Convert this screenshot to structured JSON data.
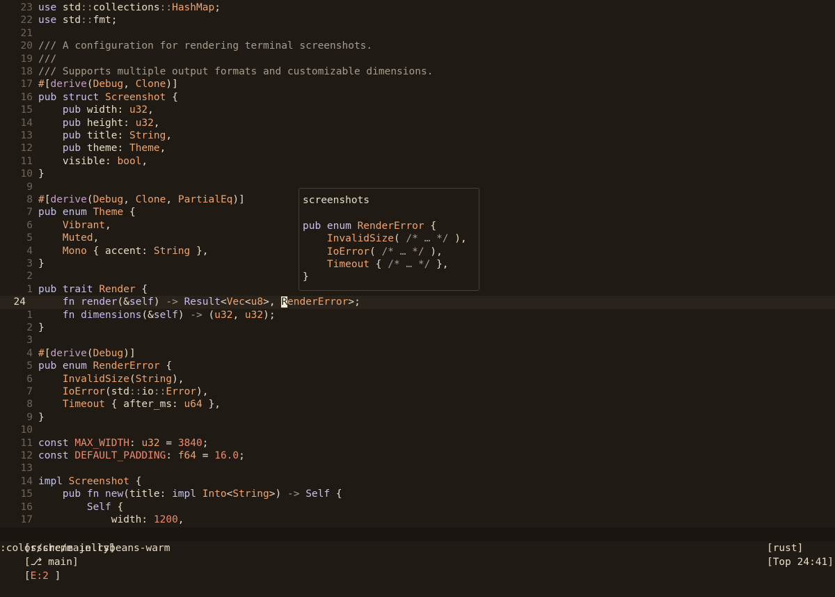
{
  "lines": [
    {
      "n": "23",
      "code": [
        [
          "k",
          "use "
        ],
        [
          "s",
          "std"
        ],
        [
          "c",
          "::"
        ],
        [
          "s",
          "collections"
        ],
        [
          "c",
          "::"
        ],
        [
          "t",
          "HashMap"
        ],
        [
          "s",
          ";"
        ]
      ]
    },
    {
      "n": "22",
      "code": [
        [
          "k",
          "use "
        ],
        [
          "s",
          "std"
        ],
        [
          "c",
          "::"
        ],
        [
          "s",
          "fmt"
        ],
        [
          "s",
          ";"
        ]
      ]
    },
    {
      "n": "21",
      "code": []
    },
    {
      "n": "20",
      "code": [
        [
          "c",
          "/// A configuration for rendering terminal screenshots."
        ]
      ]
    },
    {
      "n": "19",
      "code": [
        [
          "c",
          "///"
        ]
      ]
    },
    {
      "n": "18",
      "code": [
        [
          "c",
          "/// Supports multiple output formats and customizable dimensions."
        ]
      ]
    },
    {
      "n": "17",
      "code": [
        [
          "v",
          "#"
        ],
        [
          "s",
          "["
        ],
        [
          "a",
          "derive"
        ],
        [
          "s",
          "("
        ],
        [
          "t",
          "Debug"
        ],
        [
          "s",
          ", "
        ],
        [
          "t",
          "Clone"
        ],
        [
          "s",
          ")]"
        ]
      ]
    },
    {
      "n": "16",
      "code": [
        [
          "k",
          "pub struct "
        ],
        [
          "t",
          "Screenshot"
        ],
        [
          "s",
          " {"
        ]
      ]
    },
    {
      "n": "15",
      "code": [
        [
          "s",
          "    "
        ],
        [
          "k",
          "pub "
        ],
        [
          "f",
          "width"
        ],
        [
          "s",
          ": "
        ],
        [
          "t",
          "u32"
        ],
        [
          "s",
          ","
        ]
      ]
    },
    {
      "n": "14",
      "code": [
        [
          "s",
          "    "
        ],
        [
          "k",
          "pub "
        ],
        [
          "f",
          "height"
        ],
        [
          "s",
          ": "
        ],
        [
          "t",
          "u32"
        ],
        [
          "s",
          ","
        ]
      ]
    },
    {
      "n": "13",
      "code": [
        [
          "s",
          "    "
        ],
        [
          "k",
          "pub "
        ],
        [
          "f",
          "title"
        ],
        [
          "s",
          ": "
        ],
        [
          "t",
          "String"
        ],
        [
          "s",
          ","
        ]
      ]
    },
    {
      "n": "12",
      "code": [
        [
          "s",
          "    "
        ],
        [
          "k",
          "pub "
        ],
        [
          "f",
          "theme"
        ],
        [
          "s",
          ": "
        ],
        [
          "t",
          "Theme"
        ],
        [
          "s",
          ","
        ]
      ]
    },
    {
      "n": "11",
      "code": [
        [
          "s",
          "    visible: "
        ],
        [
          "t",
          "bool"
        ],
        [
          "s",
          ","
        ]
      ]
    },
    {
      "n": "10",
      "code": [
        [
          "s",
          "}"
        ]
      ]
    },
    {
      "n": "9",
      "code": []
    },
    {
      "n": "8",
      "code": [
        [
          "v",
          "#"
        ],
        [
          "s",
          "["
        ],
        [
          "a",
          "derive"
        ],
        [
          "s",
          "("
        ],
        [
          "t",
          "Debug"
        ],
        [
          "s",
          ", "
        ],
        [
          "t",
          "Clone"
        ],
        [
          "s",
          ", "
        ],
        [
          "t",
          "PartialEq"
        ],
        [
          "s",
          ")]"
        ]
      ]
    },
    {
      "n": "7",
      "code": [
        [
          "k",
          "pub enum "
        ],
        [
          "t",
          "Theme"
        ],
        [
          "s",
          " {"
        ]
      ]
    },
    {
      "n": "6",
      "code": [
        [
          "s",
          "    "
        ],
        [
          "v",
          "Vibrant"
        ],
        [
          "s",
          ","
        ]
      ]
    },
    {
      "n": "5",
      "code": [
        [
          "s",
          "    "
        ],
        [
          "v",
          "Muted"
        ],
        [
          "s",
          ","
        ]
      ]
    },
    {
      "n": "4",
      "code": [
        [
          "s",
          "    "
        ],
        [
          "v",
          "Mono"
        ],
        [
          "s",
          " { accent: "
        ],
        [
          "t",
          "String"
        ],
        [
          "s",
          " },"
        ]
      ]
    },
    {
      "n": "3",
      "code": [
        [
          "s",
          "}"
        ]
      ]
    },
    {
      "n": "2",
      "code": []
    },
    {
      "n": "1",
      "code": [
        [
          "k",
          "pub trait "
        ],
        [
          "t",
          "Render"
        ],
        [
          "s",
          " {"
        ]
      ]
    },
    {
      "n": "24",
      "cur": true,
      "code": [
        [
          "s",
          "    "
        ],
        [
          "k",
          "fn "
        ],
        [
          "m",
          "render"
        ],
        [
          "s",
          "(&"
        ],
        [
          "k",
          "self"
        ],
        [
          "s",
          ") "
        ],
        [
          "c",
          "->"
        ],
        [
          "s",
          " "
        ],
        [
          "m",
          "Result"
        ],
        [
          "s",
          "<"
        ],
        [
          "t",
          "Vec"
        ],
        [
          "s",
          "<"
        ],
        [
          "t",
          "u8"
        ],
        [
          "s",
          ">, "
        ],
        [
          "cursor",
          "R"
        ],
        [
          "t",
          "enderError"
        ],
        [
          "s",
          ">;"
        ]
      ]
    },
    {
      "n": "1",
      "code": [
        [
          "s",
          "    "
        ],
        [
          "k",
          "fn "
        ],
        [
          "m",
          "dimensions"
        ],
        [
          "s",
          "(&"
        ],
        [
          "k",
          "self"
        ],
        [
          "s",
          ") "
        ],
        [
          "c",
          "->"
        ],
        [
          "s",
          " ("
        ],
        [
          "t",
          "u32"
        ],
        [
          "s",
          ", "
        ],
        [
          "t",
          "u32"
        ],
        [
          "s",
          ");"
        ]
      ]
    },
    {
      "n": "2",
      "code": [
        [
          "s",
          "}"
        ]
      ]
    },
    {
      "n": "3",
      "code": []
    },
    {
      "n": "4",
      "code": [
        [
          "v",
          "#"
        ],
        [
          "s",
          "["
        ],
        [
          "a",
          "derive"
        ],
        [
          "s",
          "("
        ],
        [
          "t",
          "Debug"
        ],
        [
          "s",
          ")]"
        ]
      ]
    },
    {
      "n": "5",
      "code": [
        [
          "k",
          "pub enum "
        ],
        [
          "t",
          "RenderError"
        ],
        [
          "s",
          " {"
        ]
      ]
    },
    {
      "n": "6",
      "code": [
        [
          "s",
          "    "
        ],
        [
          "v",
          "InvalidSize"
        ],
        [
          "s",
          "("
        ],
        [
          "t",
          "String"
        ],
        [
          "s",
          "),"
        ]
      ]
    },
    {
      "n": "7",
      "code": [
        [
          "s",
          "    "
        ],
        [
          "v",
          "IoError"
        ],
        [
          "s",
          "("
        ],
        [
          "s",
          "std"
        ],
        [
          "c",
          "::"
        ],
        [
          "s",
          "io"
        ],
        [
          "c",
          "::"
        ],
        [
          "t",
          "Error"
        ],
        [
          "s",
          "),"
        ]
      ]
    },
    {
      "n": "8",
      "code": [
        [
          "s",
          "    "
        ],
        [
          "v",
          "Timeout"
        ],
        [
          "s",
          " { after_ms: "
        ],
        [
          "t",
          "u64"
        ],
        [
          "s",
          " },"
        ]
      ]
    },
    {
      "n": "9",
      "code": [
        [
          "s",
          "}"
        ]
      ]
    },
    {
      "n": "10",
      "code": []
    },
    {
      "n": "11",
      "code": [
        [
          "k",
          "const "
        ],
        [
          "n",
          "MAX_WIDTH"
        ],
        [
          "s",
          ": "
        ],
        [
          "t",
          "u32"
        ],
        [
          "s",
          " = "
        ],
        [
          "n",
          "3840"
        ],
        [
          "s",
          ";"
        ]
      ]
    },
    {
      "n": "12",
      "code": [
        [
          "k",
          "const "
        ],
        [
          "n",
          "DEFAULT_PADDING"
        ],
        [
          "s",
          ": "
        ],
        [
          "t",
          "f64"
        ],
        [
          "s",
          " = "
        ],
        [
          "n",
          "16.0"
        ],
        [
          "s",
          ";"
        ]
      ]
    },
    {
      "n": "13",
      "code": []
    },
    {
      "n": "14",
      "code": [
        [
          "k",
          "impl "
        ],
        [
          "t",
          "Screenshot"
        ],
        [
          "s",
          " {"
        ]
      ]
    },
    {
      "n": "15",
      "code": [
        [
          "s",
          "    "
        ],
        [
          "k",
          "pub fn "
        ],
        [
          "m",
          "new"
        ],
        [
          "s",
          "(title: "
        ],
        [
          "k",
          "impl "
        ],
        [
          "t",
          "Into"
        ],
        [
          "s",
          "<"
        ],
        [
          "t",
          "String"
        ],
        [
          "s",
          ">) "
        ],
        [
          "c",
          "->"
        ],
        [
          "s",
          " "
        ],
        [
          "k",
          "Self"
        ],
        [
          "s",
          " {"
        ]
      ]
    },
    {
      "n": "16",
      "code": [
        [
          "s",
          "        "
        ],
        [
          "k",
          "Self"
        ],
        [
          "s",
          " {"
        ]
      ]
    },
    {
      "n": "17",
      "code": [
        [
          "s",
          "            width: "
        ],
        [
          "n",
          "1200"
        ],
        [
          "s",
          ","
        ]
      ]
    }
  ],
  "hover": {
    "lines": [
      [
        [
          "s",
          "screenshots"
        ]
      ],
      [],
      [
        [
          "k",
          "pub enum "
        ],
        [
          "t",
          "RenderError"
        ],
        [
          "s",
          " {"
        ]
      ],
      [
        [
          "s",
          "    "
        ],
        [
          "v",
          "InvalidSize"
        ],
        [
          "s",
          "( "
        ],
        [
          "c",
          "/* … */"
        ],
        [
          "s",
          " ),"
        ]
      ],
      [
        [
          "s",
          "    "
        ],
        [
          "v",
          "IoError"
        ],
        [
          "s",
          "( "
        ],
        [
          "c",
          "/* … */"
        ],
        [
          "s",
          " ),"
        ]
      ],
      [
        [
          "s",
          "    "
        ],
        [
          "v",
          "Timeout"
        ],
        [
          "s",
          " { "
        ],
        [
          "c",
          "/* … */"
        ],
        [
          "s",
          " },"
        ]
      ],
      [
        [
          "s",
          "}"
        ]
      ]
    ]
  },
  "status": {
    "file": "[s/src/main.rs]",
    "branch": "[⎇ main]",
    "errors_prefix": "[",
    "errors": "E:2",
    "errors_suffix": " ]",
    "filetype": "[rust]",
    "position": "[Top 24:41]"
  },
  "cmdline": ":colorscheme jellybeans-warm",
  "colors": {
    "background": "#1f1a14",
    "keyword": "#c7c2ea",
    "type": "#f0a46a",
    "comment": "#a79c8c",
    "number": "#f08a6c",
    "error": "#f08a6c"
  }
}
